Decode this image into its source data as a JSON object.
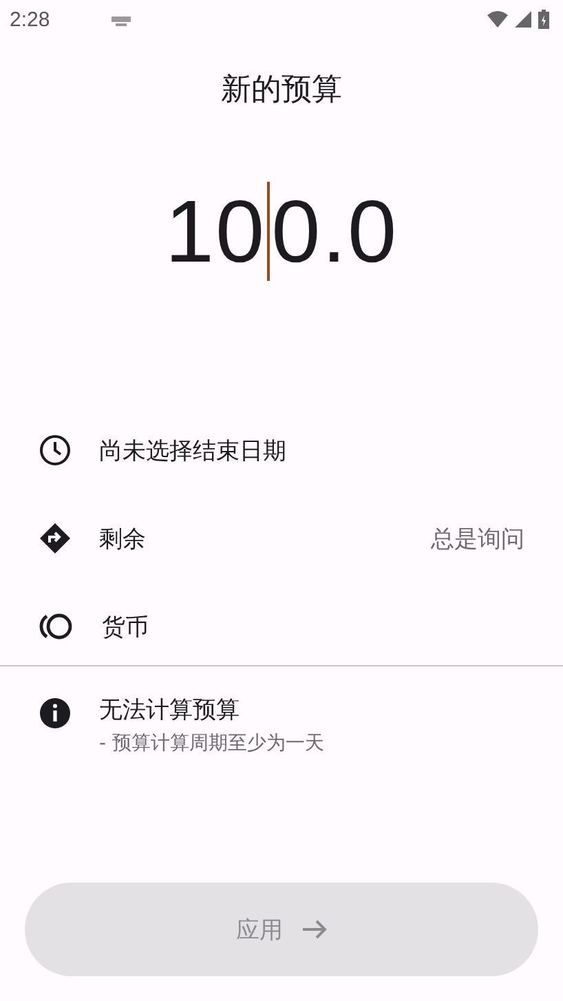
{
  "status_bar": {
    "time": "2:28"
  },
  "title": "新的预算",
  "amount": {
    "before_cursor": "10",
    "after_cursor": "0.0"
  },
  "settings": [
    {
      "kind": "date",
      "label": "尚未选择结束日期"
    },
    {
      "kind": "remaining",
      "label": "剩余",
      "value": "总是询问"
    },
    {
      "kind": "currency",
      "label": "货币"
    }
  ],
  "notice": {
    "title": "无法计算预算",
    "detail": "- 预算计算周期至少为一天"
  },
  "apply_button": {
    "label": "应用",
    "disabled": true
  }
}
